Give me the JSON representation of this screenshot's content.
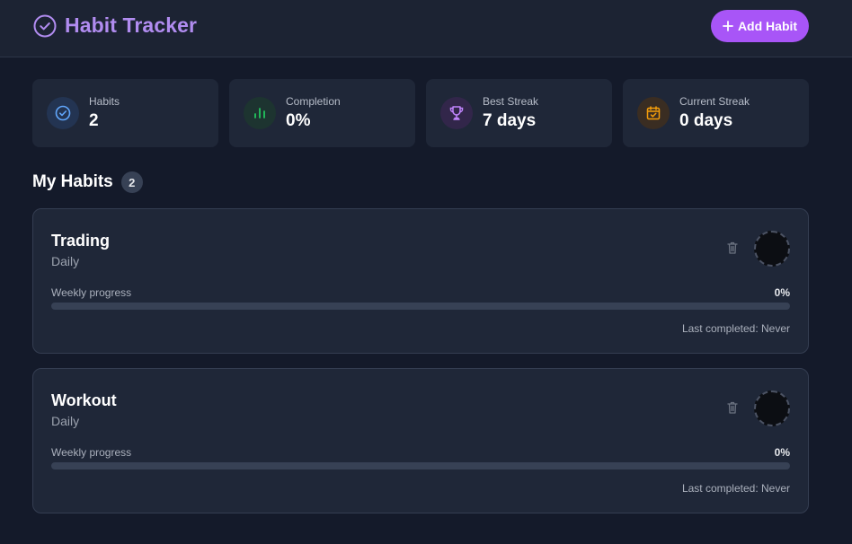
{
  "header": {
    "title": "Habit Tracker",
    "title_icon": "check-circle-icon",
    "add_button_label": "Add Habit",
    "add_button_icon": "plus-icon",
    "accent_color": "#a855f7"
  },
  "stats": [
    {
      "label": "Habits",
      "value": "2",
      "icon": "check-circle-icon",
      "color": "#3b82f6"
    },
    {
      "label": "Completion",
      "value": "0%",
      "icon": "bar-chart-icon",
      "color": "#22c55e"
    },
    {
      "label": "Best Streak",
      "value": "7 days",
      "icon": "trophy-icon",
      "color": "#a855f7"
    },
    {
      "label": "Current Streak",
      "value": "0 days",
      "icon": "calendar-check-icon",
      "color": "#f59e0b"
    }
  ],
  "habits_section": {
    "title": "My Habits",
    "count": "2"
  },
  "habits": [
    {
      "name": "Trading",
      "frequency": "Daily",
      "progress_label": "Weekly progress",
      "progress_text": "0%",
      "progress_value": 0,
      "last_completed": "Last completed: Never"
    },
    {
      "name": "Workout",
      "frequency": "Daily",
      "progress_label": "Weekly progress",
      "progress_text": "0%",
      "progress_value": 0,
      "last_completed": "Last completed: Never"
    }
  ]
}
